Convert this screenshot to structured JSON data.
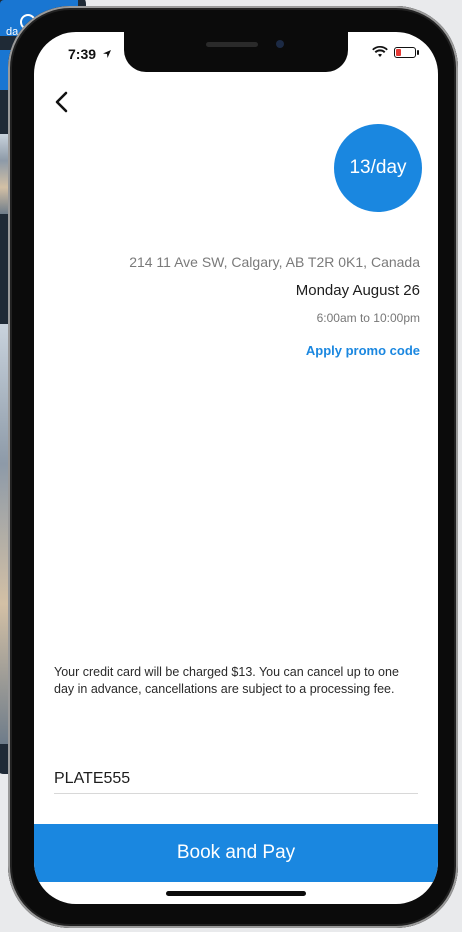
{
  "background_app": {
    "header_label": "da"
  },
  "status_bar": {
    "time": "7:39"
  },
  "rate": {
    "label": "13/day"
  },
  "booking": {
    "address": "214 11 Ave SW, Calgary, AB T2R 0K1, Canada",
    "date": "Monday August 26",
    "time_range": "6:00am to 10:00pm",
    "promo_label": "Apply promo code"
  },
  "notice": {
    "text": "Your credit card will be charged $13. You can cancel up to one day in advance, cancellations are subject to a processing fee."
  },
  "plate": {
    "value": "PLATE555"
  },
  "actions": {
    "book_label": "Book and Pay"
  },
  "colors": {
    "accent": "#1a87e0"
  },
  "icons": {
    "back": "chevron-left-icon",
    "location_arrow": "location-arrow-icon",
    "wifi": "wifi-icon",
    "battery": "battery-low-icon"
  }
}
